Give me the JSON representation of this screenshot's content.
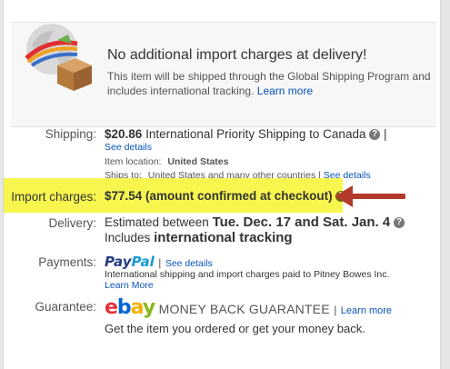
{
  "banner": {
    "title": "No additional import charges at delivery!",
    "description": "This item will be shipped through the Global Shipping Program and includes international tracking.",
    "learn_more": "Learn more"
  },
  "shipping": {
    "label": "Shipping:",
    "price": "$20.86",
    "service": "International Priority Shipping to Canada",
    "see_details": "See details",
    "item_location_label": "Item location:",
    "item_location": "United States",
    "ships_to_label": "Ships to:",
    "ships_to": "United States and many other countries",
    "ships_to_details": "See details"
  },
  "import_charges": {
    "label": "Import charges:",
    "value": "$77.54 (amount confirmed at checkout)",
    "highlight_color": "#f7f64e",
    "arrow_color": "#b23a2a"
  },
  "delivery": {
    "label": "Delivery:",
    "estimated_prefix": "Estimated between",
    "dates": "Tue. Dec. 17 and Sat. Jan. 4",
    "includes_prefix": "Includes",
    "includes_bold": "international tracking"
  },
  "payments": {
    "label": "Payments:",
    "logo_pay": "Pay",
    "logo_pal": "Pal",
    "see_details": "See details",
    "note": "International shipping and import charges paid to Pitney Bowes Inc.",
    "learn_more": "Learn More"
  },
  "guarantee": {
    "label": "Guarantee:",
    "ebay_e": "e",
    "ebay_b": "b",
    "ebay_a": "a",
    "ebay_y": "y",
    "mbg": "MONEY BACK GUARANTEE",
    "learn_more": "Learn more",
    "tagline": "Get the item you ordered or get your money back."
  },
  "icons": {
    "help": "?",
    "pipe": "|"
  }
}
